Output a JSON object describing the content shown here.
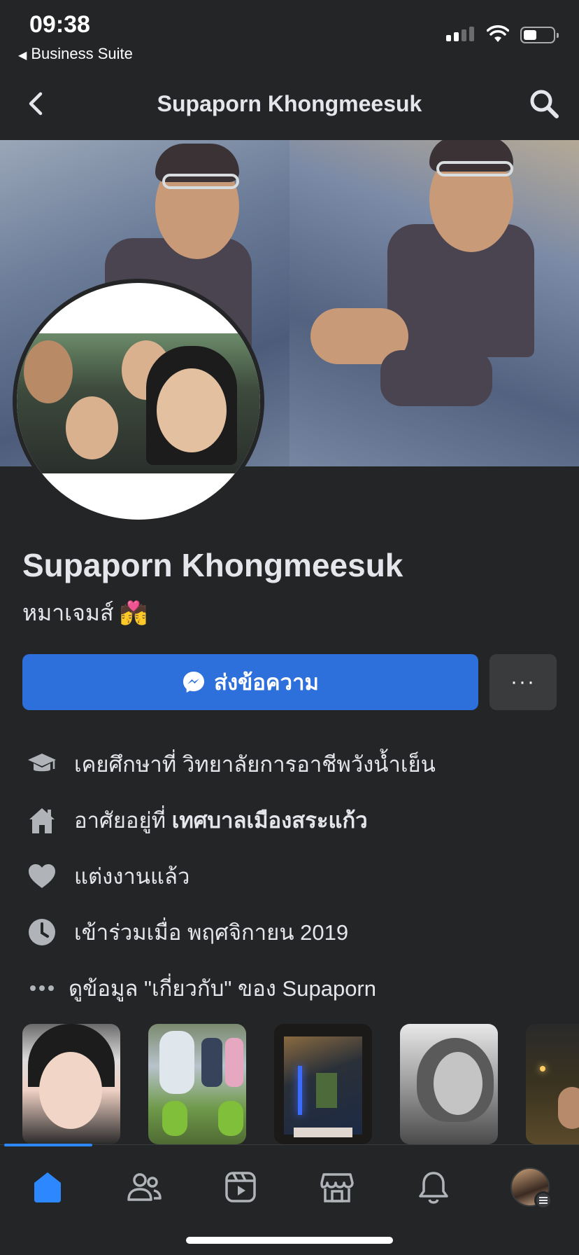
{
  "status_bar": {
    "time": "09:38",
    "back_app": "Business Suite"
  },
  "header": {
    "title": "Supaporn Khongmeesuk"
  },
  "profile": {
    "name": "Supaporn Khongmeesuk",
    "nickname": "หมาเจมส์ 💏",
    "message_button": "ส่งข้อความ",
    "more_button": "···"
  },
  "intro": {
    "education_prefix": "เคยศึกษาที่ ",
    "education_place": "วิทยาลัยการอาชีพวังน้ำเย็น",
    "lives_prefix": "อาศัยอยู่ที่ ",
    "lives_place": "เทศบาลเมืองสระแก้ว",
    "relationship": "แต่งงานแล้ว",
    "joined": "เข้าร่วมเมื่อ พฤศจิกายน  2019",
    "about_link": "ดูข้อมูล \"เกี่ยวกับ\" ของ Supaporn",
    "icons": [
      "graduation-cap-icon",
      "home-icon",
      "heart-icon",
      "clock-icon",
      "ellipsis-icon"
    ]
  },
  "tabs": [
    "home",
    "friends",
    "watch",
    "marketplace",
    "notifications",
    "menu"
  ],
  "colors": {
    "background": "#242526",
    "accent": "#2d6fdb",
    "active_tab": "#2d88ff",
    "secondary_button": "#3a3b3c"
  }
}
